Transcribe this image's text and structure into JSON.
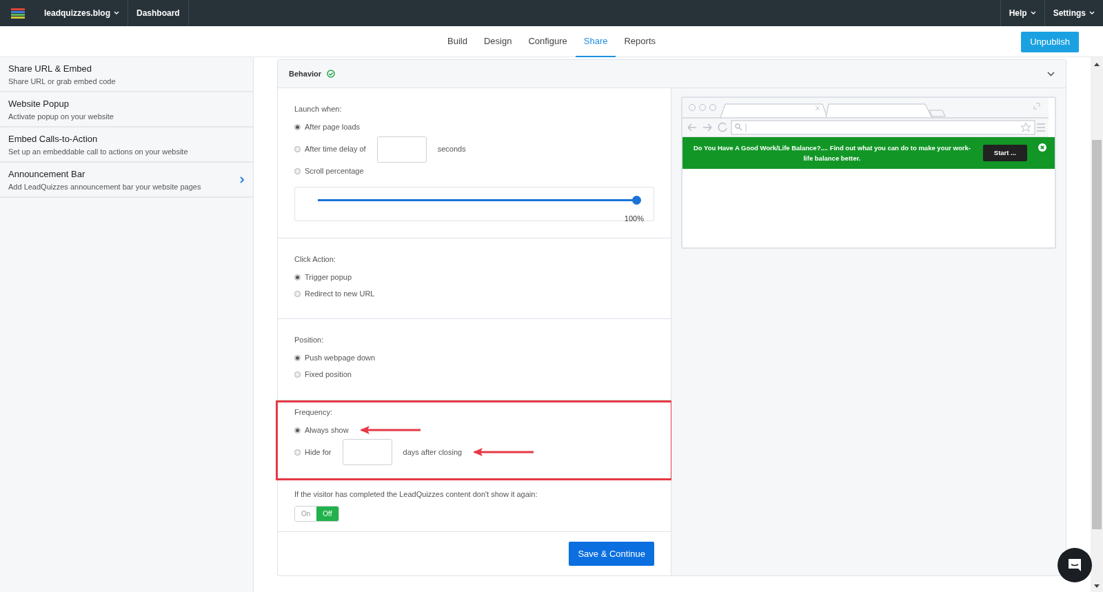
{
  "navbar": {
    "brand": "leadquizzes.blog",
    "links": [
      "Dashboard"
    ],
    "menus": [
      "Help",
      "Settings"
    ]
  },
  "tabs": [
    {
      "label": "Build",
      "selected": false
    },
    {
      "label": "Design",
      "selected": false
    },
    {
      "label": "Configure",
      "selected": false
    },
    {
      "label": "Share",
      "selected": true
    },
    {
      "label": "Reports",
      "selected": false
    }
  ],
  "publish_button": "Unpublish",
  "sidebar": {
    "items": [
      {
        "title": "Share URL & Embed",
        "subtitle": "Share URL or grab embed code",
        "selected": false
      },
      {
        "title": "Website Popup",
        "subtitle": "Activate popup on your website",
        "selected": false
      },
      {
        "title": "Embed Calls-to-Action",
        "subtitle": "Set up an embeddable call to actions on your website",
        "selected": false
      },
      {
        "title": "Announcement Bar",
        "subtitle": "Add LeadQuizzes announcement bar your website pages",
        "selected": true
      }
    ]
  },
  "panel": {
    "title": "Behavior",
    "complete": true,
    "sections": [
      {
        "label": "Launch when:",
        "highlighted": false,
        "options": [
          {
            "kind": "plain",
            "label": "After page loads",
            "selected": true,
            "annotated": false
          },
          {
            "kind": "input",
            "label": "After time delay of",
            "suffix": "seconds",
            "selected": false,
            "annotated": false
          },
          {
            "kind": "plain",
            "label": "Scroll percentage",
            "selected": false,
            "annotated": false
          }
        ],
        "slider": {
          "level": 1,
          "reading": "100%"
        }
      },
      {
        "label": "Click Action:",
        "highlighted": false,
        "options": [
          {
            "kind": "plain",
            "label": "Trigger popup",
            "selected": true,
            "annotated": false
          },
          {
            "kind": "plain",
            "label": "Redirect to new URL",
            "selected": false,
            "annotated": false
          }
        ]
      },
      {
        "label": "Position:",
        "highlighted": false,
        "options": [
          {
            "kind": "plain",
            "label": "Push webpage down",
            "selected": true,
            "annotated": false
          },
          {
            "kind": "plain",
            "label": "Fixed position",
            "selected": false,
            "annotated": false
          }
        ]
      },
      {
        "label": "Frequency:",
        "highlighted": true,
        "options": [
          {
            "kind": "plain",
            "label": "Always show",
            "selected": true,
            "annotated": true
          },
          {
            "kind": "input",
            "label": "Hide for",
            "suffix": "days after closing",
            "selected": false,
            "annotated": true
          }
        ]
      }
    ],
    "completion": {
      "label": "If the visitor has completed the LeadQuizzes content don't show it again:",
      "options": [
        {
          "label": "On",
          "selected": false
        },
        {
          "label": "Off",
          "selected": true
        }
      ]
    },
    "save_button": "Save & Continue",
    "preview": {
      "banner_text": "Do You Have A Good Work/Life Balance?.... Find out what you can do to make your work-life balance better.",
      "banner_button": "Start ..."
    }
  }
}
